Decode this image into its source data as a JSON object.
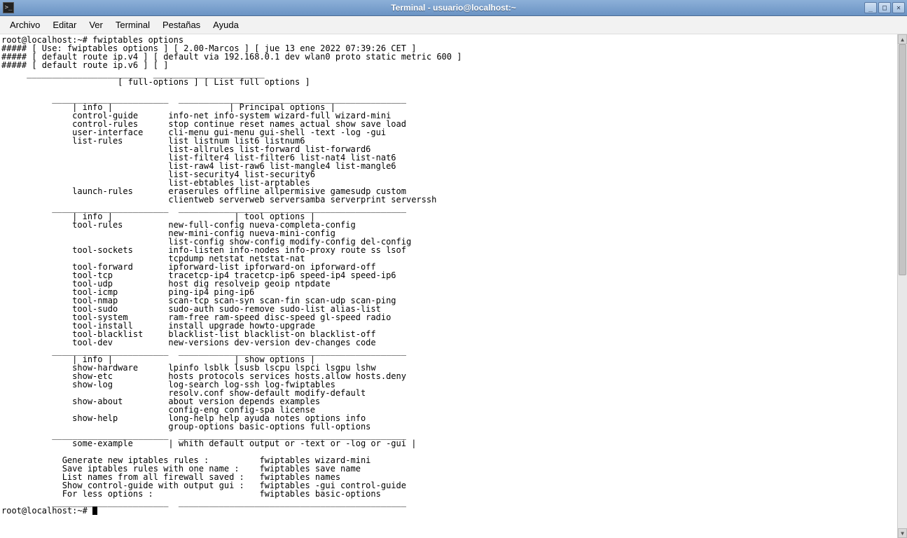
{
  "window": {
    "title": "Terminal - usuario@localhost:~",
    "min_tip": "_",
    "max_tip": "□",
    "close_tip": "✕"
  },
  "menu": {
    "archivo": "Archivo",
    "editar": "Editar",
    "ver": "Ver",
    "terminal": "Terminal",
    "pestanas": "Pestañas",
    "ayuda": "Ayuda"
  },
  "prompt1": "root@localhost:~# ",
  "command1": "fwiptables options",
  "header_lines": [
    "##### [ Use: fwiptables options ] [ 2.00-Marcos ] [ jue 13 ene 2022 07:39:26 CET ]",
    "##### [ default route ip.v4 ] [ default via 192.168.0.1 dev wlan0 proto static metric 600 ]",
    "##### [ default route ip.v6 ] [ ]"
  ],
  "sep_short": "     _______________________  ______________________",
  "full_options_line": "                       [ full-options ] [ List full options ]",
  "sep_top": "          _______________________  _____________________________________________",
  "principal_header": "              | info |                       | Principal options |",
  "principal_rows": [
    "              control-guide      info-net info-system wizard-full wizard-mini",
    "              control-rules      stop continue reset names actual show save load",
    "              user-interface     cli-menu gui-menu gui-shell -text -log -gui",
    "              list-rules         list listnum list6 listnum6",
    "                                 list-allrules list-forward list-forward6",
    "                                 list-filter4 list-filter6 list-nat4 list-nat6",
    "                                 list-raw4 list-raw6 list-mangle4 list-mangle6",
    "                                 list-security4 list-security6",
    "                                 list-ebtables list-arptables",
    "              launch-rules       eraserules offline allpermisive gamesudp custom",
    "                                 clientweb serverweb serversamba serverprint serverssh"
  ],
  "tool_header": "              | info |                        | tool options |",
  "tool_rows": [
    "              tool-rules         new-full-config nueva-completa-config",
    "                                 new-mini-config nueva-mini-config",
    "                                 list-config show-config modify-config del-config",
    "              tool-sockets       info-listen info-nodes info-proxy route ss lsof",
    "                                 tcpdump netstat netstat-nat",
    "              tool-forward       ipforward-list ipforward-on ipforward-off",
    "              tool-tcp           tracetcp-ip4 tracetcp-ip6 speed-ip4 speed-ip6",
    "              tool-udp           host dig resolveip geoip ntpdate",
    "              tool-icmp          ping-ip4 ping-ip6",
    "              tool-nmap          scan-tcp scan-syn scan-fin scan-udp scan-ping",
    "              tool-sudo          sudo-auth sudo-remove sudo-list alias-list",
    "              tool-system        ram-free ram-speed disc-speed gl-speed radio",
    "              tool-install       install upgrade howto-upgrade",
    "              tool-blacklist     blacklist-list blacklist-on blacklist-off",
    "              tool-dev           new-versions dev-version dev-changes code"
  ],
  "show_header": "              | info |                        | show options |",
  "show_rows": [
    "              show-hardware      lpinfo lsblk lsusb lscpu lspci lsgpu lshw",
    "              show-etc           hosts protocols services hosts.allow hosts.deny",
    "              show-log           log-search log-ssh log-fwiptables",
    "                                 resolv.conf show-default modify-default",
    "              show-about         about version depends examples",
    "                                 config-eng config-spa license",
    "              show-help          long-help help ayuda notes options info",
    "                                 group-options basic-options full-options"
  ],
  "example_header": "              some-example       | whith default output or -text or -log or -gui |",
  "example_rows": [
    "            Generate new iptables rules :          fwiptables wizard-mini",
    "            Save iptables rules with one name :    fwiptables save name",
    "            List names from all firewall saved :   fwiptables names",
    "            Show control-guide with output gui :   fwiptables -gui control-guide",
    "            For less options :                     fwiptables basic-options"
  ],
  "sep_bottom": "          _______________________  _____________________________________________",
  "prompt2": "root@localhost:~# "
}
